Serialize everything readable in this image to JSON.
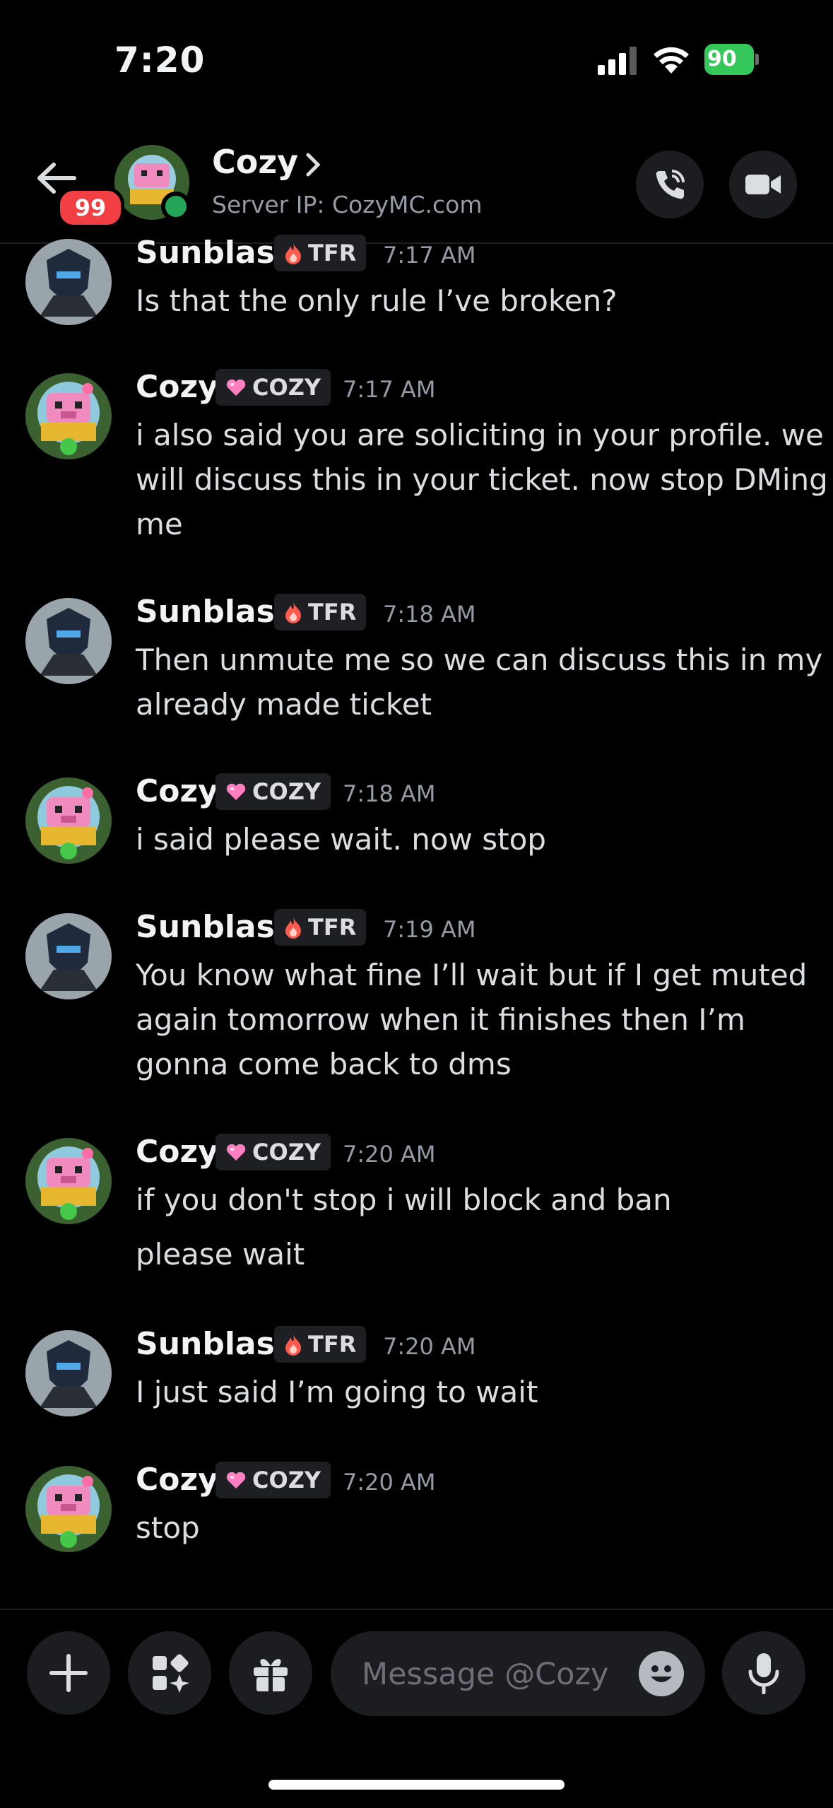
{
  "status": {
    "time": "7:20",
    "battery": "90"
  },
  "header": {
    "badge": "99",
    "name": "Cozy",
    "subtitle": "Server IP: CozyMC.com"
  },
  "messages": [
    {
      "author": "Sunblast",
      "tag": "TFR",
      "time": "7:17 AM",
      "lines": [
        "Is that the only rule I’ve broken?"
      ]
    },
    {
      "author": "Cozy",
      "tag": "COZY",
      "time": "7:17 AM",
      "lines": [
        "i also said you are soliciting in your profile. we",
        "will discuss this in your ticket. now stop DMing",
        "me"
      ]
    },
    {
      "author": "Sunblast",
      "tag": "TFR",
      "time": "7:18 AM",
      "lines": [
        "Then unmute me so we can discuss this in my",
        "already made ticket"
      ]
    },
    {
      "author": "Cozy",
      "tag": "COZY",
      "time": "7:18 AM",
      "lines": [
        "i said please wait. now stop"
      ]
    },
    {
      "author": "Sunblast",
      "tag": "TFR",
      "time": "7:19 AM",
      "lines": [
        "You know what fine I’ll wait but if I get muted",
        "again tomorrow when it finishes then I’m",
        "gonna come back to dms"
      ]
    },
    {
      "author": "Cozy",
      "tag": "COZY",
      "time": "7:20 AM",
      "lines": [
        "if you don't stop i will block and ban",
        "please wait"
      ]
    },
    {
      "author": "Sunblast",
      "tag": "TFR",
      "time": "7:20 AM",
      "lines": [
        "I just said I’m going to wait"
      ]
    },
    {
      "author": "Cozy",
      "tag": "COZY",
      "time": "7:20 AM",
      "lines": [
        "stop"
      ]
    }
  ],
  "composer": {
    "placeholder": "Message @Cozy"
  }
}
